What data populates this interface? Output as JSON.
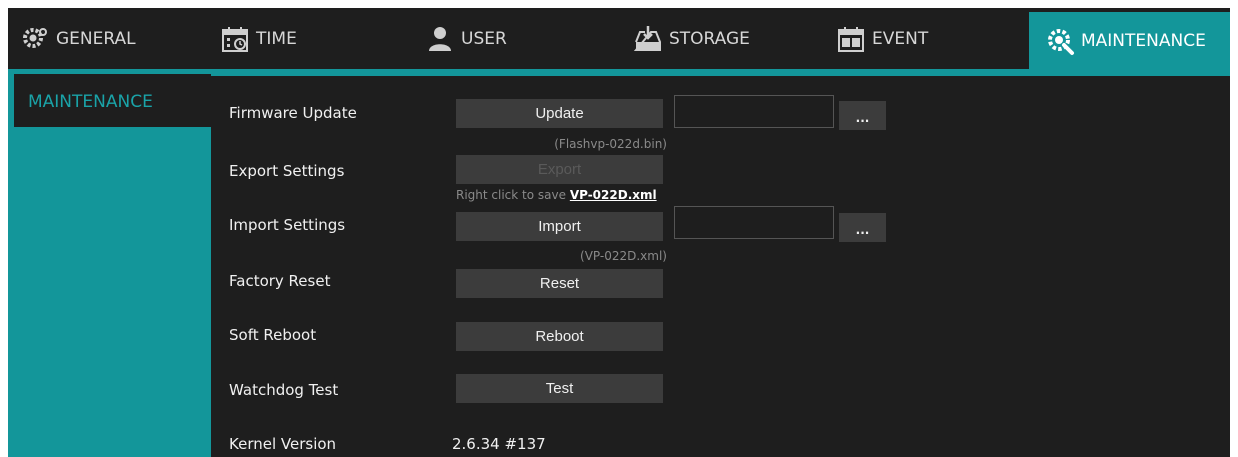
{
  "tabs": [
    {
      "label": "GENERAL",
      "icon": "gear-icon",
      "active": false
    },
    {
      "label": "TIME",
      "icon": "calendar-clock-icon",
      "active": false
    },
    {
      "label": "USER",
      "icon": "user-icon",
      "active": false
    },
    {
      "label": "STORAGE",
      "icon": "storage-download-icon",
      "active": false
    },
    {
      "label": "EVENT",
      "icon": "event-calendar-icon",
      "active": false
    },
    {
      "label": "MAINTENANCE",
      "icon": "maintenance-gear-icon",
      "active": true
    }
  ],
  "sidebar": {
    "items": [
      {
        "label": "MAINTENANCE",
        "active": true
      }
    ]
  },
  "maintenance": {
    "firmware": {
      "label": "Firmware Update",
      "button": "Update",
      "browse": "...",
      "hint": "(Flashvp-022d.bin)",
      "file_value": ""
    },
    "export": {
      "label": "Export Settings",
      "button": "Export",
      "hint_prefix": "Right click to save",
      "link": "VP-022D.xml"
    },
    "import": {
      "label": "Import Settings",
      "button": "Import",
      "browse": "...",
      "hint": "(VP-022D.xml)",
      "file_value": ""
    },
    "factory_reset": {
      "label": "Factory Reset",
      "button": "Reset"
    },
    "soft_reboot": {
      "label": "Soft Reboot",
      "button": "Reboot"
    },
    "watchdog": {
      "label": "Watchdog Test",
      "button": "Test"
    },
    "kernel": {
      "label": "Kernel Version",
      "value": "2.6.34 #137"
    }
  },
  "colors": {
    "accent": "#13969a",
    "panel": "#1e1e1e",
    "button": "#3c3c3c",
    "text": "#f0f0f0",
    "hint": "#8a8a8a"
  }
}
